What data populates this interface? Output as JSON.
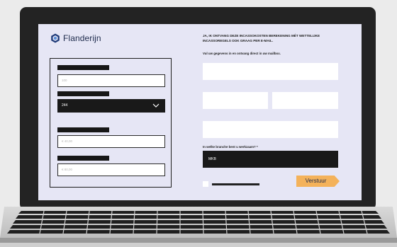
{
  "brand": {
    "name": "Flanderijn",
    "icon": "hexagon-logo-icon"
  },
  "left_form": {
    "field1_placeholder": "100",
    "select_value": "244",
    "field2_placeholder": "€ 40,00",
    "field3_placeholder": "€ 80,00"
  },
  "right_form": {
    "heading": "JA, IK ONTVANG DEZE INCASSOKOSTEN BEREKENING MÉT WETTELIJKE INCASSOREGELS OOK GRAAG PER E-MAIL.",
    "subtext": "Vul uw gegevens in en ontvang direct in uw mailbox.",
    "branche_label": "In welke branche bent u werkzaam? *",
    "branche_value": "MKB",
    "submit_label": "Verstuur"
  },
  "colors": {
    "screen_bg": "#e6e6f5",
    "accent": "#f4b25a",
    "dark": "#191919"
  }
}
